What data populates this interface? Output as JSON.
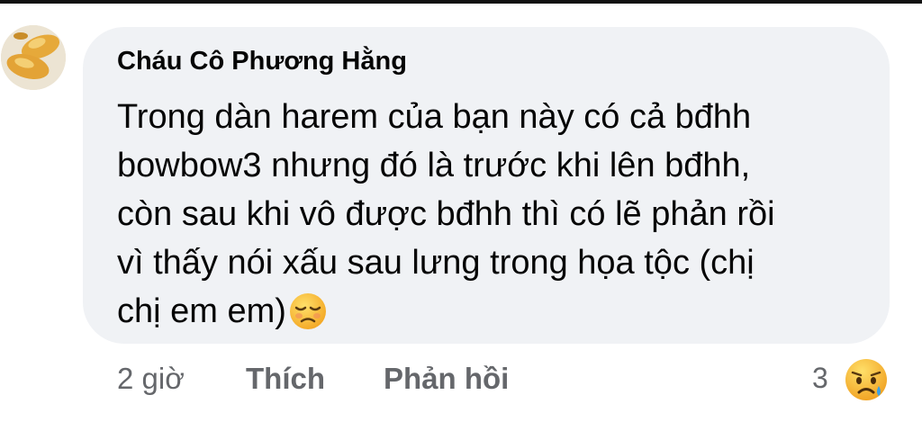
{
  "comment": {
    "author": "Cháu Cô Phương Hằng",
    "lines": [
      "Trong dàn harem của bạn này có cả bđhh",
      "bowbow3 nhưng đó là trước khi lên bđhh,",
      "còn sau khi vô được bđhh thì có lẽ phản rồi",
      "vì thấy nói xấu sau lưng trong họa tộc (chị",
      "chị em em)"
    ],
    "inline_emoji": "disappointed-face-icon"
  },
  "actions": {
    "time": "2 giờ",
    "like_label": "Thích",
    "reply_label": "Phản hồi"
  },
  "reactions": {
    "count": "3",
    "emoji": "sad-tear-face-icon"
  },
  "colors": {
    "bubble_bg": "#f0f2f5",
    "text": "#050505",
    "secondary_text": "#65676b"
  }
}
